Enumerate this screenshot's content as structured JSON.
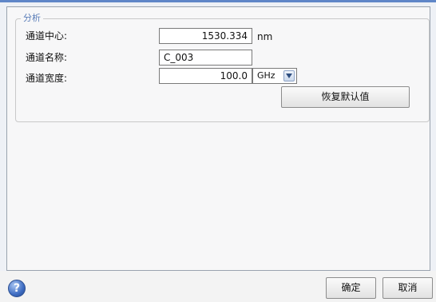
{
  "group": {
    "title": "分析"
  },
  "fields": {
    "center": {
      "label": "通道中心:",
      "value": "1530.334",
      "unit": "nm"
    },
    "name": {
      "label": "通道名称:",
      "value": "C_003"
    },
    "width": {
      "label": "通道宽度:",
      "value": "100.0",
      "unit_selected": "GHz"
    }
  },
  "buttons": {
    "restore_default": "恢复默认值",
    "ok": "确定",
    "cancel": "取消",
    "help": "?"
  },
  "icons": {
    "help": "help-icon",
    "dropdown": "chevron-down-icon"
  },
  "colors": {
    "accent": "#5f86c8",
    "group_title": "#5a7db8"
  }
}
